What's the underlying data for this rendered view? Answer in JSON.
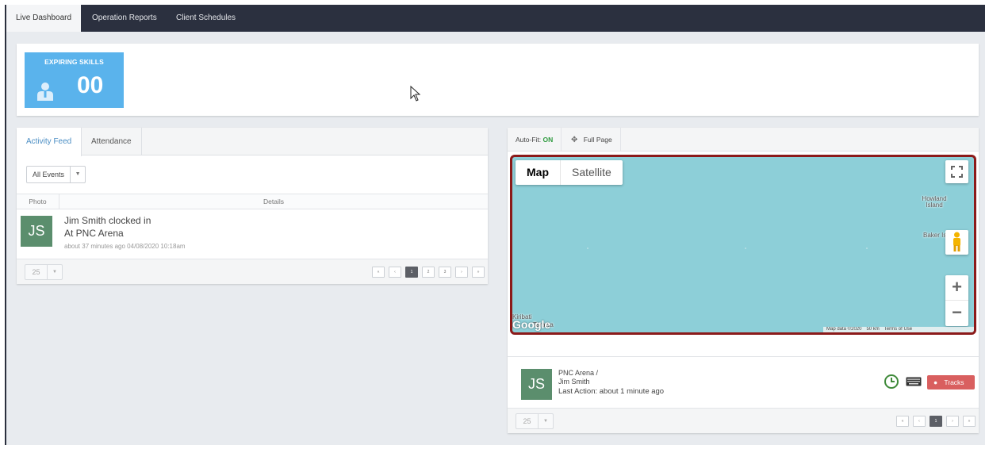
{
  "nav": {
    "tabs": [
      {
        "label": "Live Dashboard"
      },
      {
        "label": "Operation Reports"
      },
      {
        "label": "Client Schedules"
      }
    ]
  },
  "banner": {
    "tile_label": "EXPIRING SKILLS",
    "tile_value": "00",
    "tile_color": "#5ab3ec"
  },
  "activity": {
    "tabs": [
      "Activity Feed",
      "Attendance"
    ],
    "filter_label": "All Events",
    "columns": {
      "photo": "Photo",
      "details": "Details"
    },
    "rows": [
      {
        "initials": "JS",
        "line1": "Jim Smith clocked in",
        "line2": "At PNC Arena",
        "meta": "about 37 minutes ago   04/08/2020 10:18am"
      }
    ],
    "page_size": "25",
    "pager": [
      "«",
      "‹",
      "1",
      "2",
      "3",
      "›",
      "»"
    ],
    "current_page": "1"
  },
  "map_panel": {
    "autofit_label": "Auto-Fit:",
    "autofit_value": "ON",
    "fullpage_label": "Full Page",
    "map_types": [
      "Map",
      "Satellite"
    ],
    "places": [
      "Howland Island",
      "Baker Is",
      "Kiribati",
      "Tarawa"
    ],
    "zoom_in": "+",
    "zoom_out": "−",
    "logo": "Google",
    "footer": [
      "Map data ©2020",
      "50 km",
      "Terms of Use"
    ],
    "track": {
      "initials": "JS",
      "line1": "PNC Arena /",
      "line2": "Jim Smith",
      "line3": "Last Action: about 1 minute ago",
      "tracks_label": "Tracks"
    },
    "page_size": "25",
    "pager": [
      "«",
      "‹",
      "1",
      "›",
      "»"
    ],
    "current_page": "1"
  }
}
